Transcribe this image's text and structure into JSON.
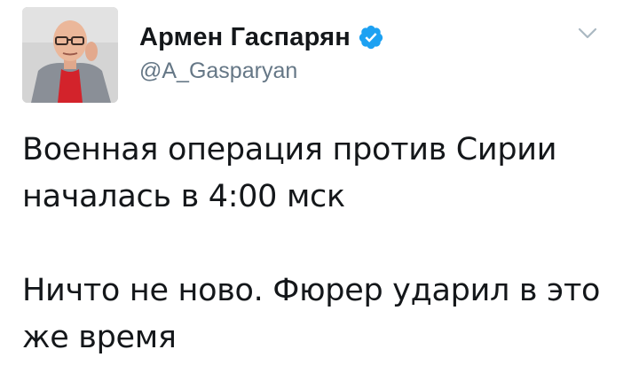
{
  "tweet": {
    "author": {
      "name": "Армен Гаспарян",
      "handle": "@A_Gasparyan",
      "verified": true
    },
    "paragraphs": [
      {
        "lines": [
          "Военная операция против Сирии",
          "началась в 4:00 мск"
        ]
      },
      {
        "lines": [
          "Ничто не ново. Фюрер ударил в это",
          "же время"
        ]
      }
    ],
    "icons": {
      "verified": "verified-badge-icon",
      "menu": "chevron-down-icon"
    },
    "colors": {
      "text": "#14171a",
      "secondary": "#657786",
      "verified": "#1da1f2",
      "caret": "#aab8c2"
    }
  }
}
